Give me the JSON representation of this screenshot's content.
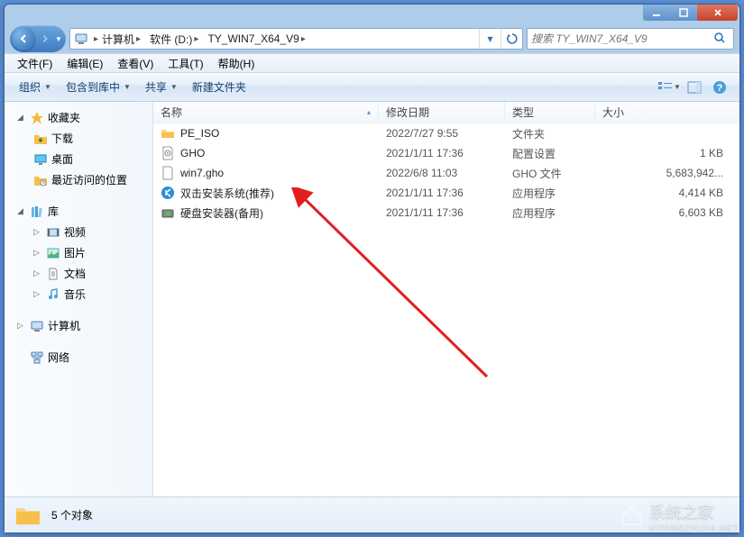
{
  "breadcrumb": {
    "segments": [
      "计算机",
      "软件 (D:)",
      "TY_WIN7_X64_V9"
    ]
  },
  "search": {
    "placeholder": "搜索 TY_WIN7_X64_V9"
  },
  "menubar": {
    "file": "文件(F)",
    "edit": "编辑(E)",
    "view": "查看(V)",
    "tools": "工具(T)",
    "help": "帮助(H)"
  },
  "toolbar": {
    "organize": "组织",
    "include": "包含到库中",
    "share": "共享",
    "newfolder": "新建文件夹"
  },
  "sidebar": {
    "favorites": {
      "label": "收藏夹",
      "items": [
        "下载",
        "桌面",
        "最近访问的位置"
      ]
    },
    "libraries": {
      "label": "库",
      "items": [
        "视频",
        "图片",
        "文档",
        "音乐"
      ]
    },
    "computer": {
      "label": "计算机"
    },
    "network": {
      "label": "网络"
    }
  },
  "columns": {
    "name": "名称",
    "date": "修改日期",
    "type": "类型",
    "size": "大小"
  },
  "files": [
    {
      "name": "PE_ISO",
      "date": "2022/7/27 9:55",
      "type": "文件夹",
      "size": "",
      "icon": "folder"
    },
    {
      "name": "GHO",
      "date": "2021/1/11 17:36",
      "type": "配置设置",
      "size": "1 KB",
      "icon": "ini"
    },
    {
      "name": "win7.gho",
      "date": "2022/6/8 11:03",
      "type": "GHO 文件",
      "size": "5,683,942...",
      "icon": "file"
    },
    {
      "name": "双击安装系统(推荐)",
      "date": "2021/1/11 17:36",
      "type": "应用程序",
      "size": "4,414 KB",
      "icon": "exe-blue"
    },
    {
      "name": "硬盘安装器(备用)",
      "date": "2021/1/11 17:36",
      "type": "应用程序",
      "size": "6,603 KB",
      "icon": "exe-green"
    }
  ],
  "status": {
    "count": "5 个对象"
  },
  "watermark": {
    "main": "系统之家",
    "sub": "XITONGZHIJIA.NET"
  }
}
